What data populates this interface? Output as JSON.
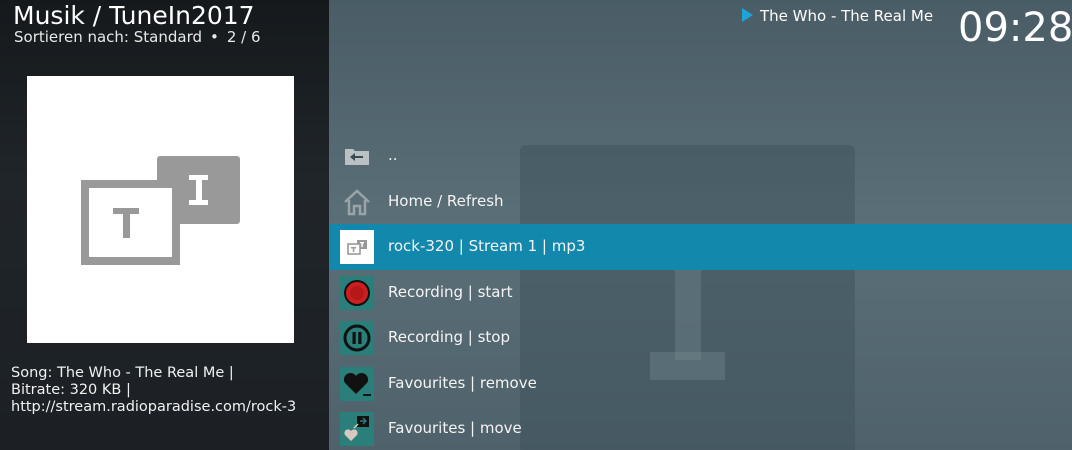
{
  "header": {
    "title": "Musik / TuneIn2017",
    "sort_label": "Sortieren nach: Standard",
    "bullet": "•",
    "position": "2 / 6",
    "now_playing": "The Who  -  The Real Me",
    "clock": "09:28"
  },
  "info": {
    "song": "Song: The Who  -  The Real Me |",
    "bitrate": "Bitrate: 320 KB |",
    "url": "http://stream.radioparadise.com/rock-3"
  },
  "list": {
    "items": [
      {
        "label": "..",
        "icon": "folder-back-icon"
      },
      {
        "label": "Home / Refresh",
        "icon": "home-icon"
      },
      {
        "label": "rock-320 | Stream 1 | mp3",
        "icon": "tunein-icon",
        "selected": true
      },
      {
        "label": "Recording | start",
        "icon": "record-icon"
      },
      {
        "label": "Recording | stop",
        "icon": "pause-icon"
      },
      {
        "label": "Favourites | remove",
        "icon": "heart-remove-icon"
      },
      {
        "label": "Favourites | move",
        "icon": "heart-move-icon"
      }
    ]
  },
  "colors": {
    "selected_row": "#1288ad",
    "play_accent": "#1ea3d6",
    "icon_teal": "#2a7f7a"
  }
}
